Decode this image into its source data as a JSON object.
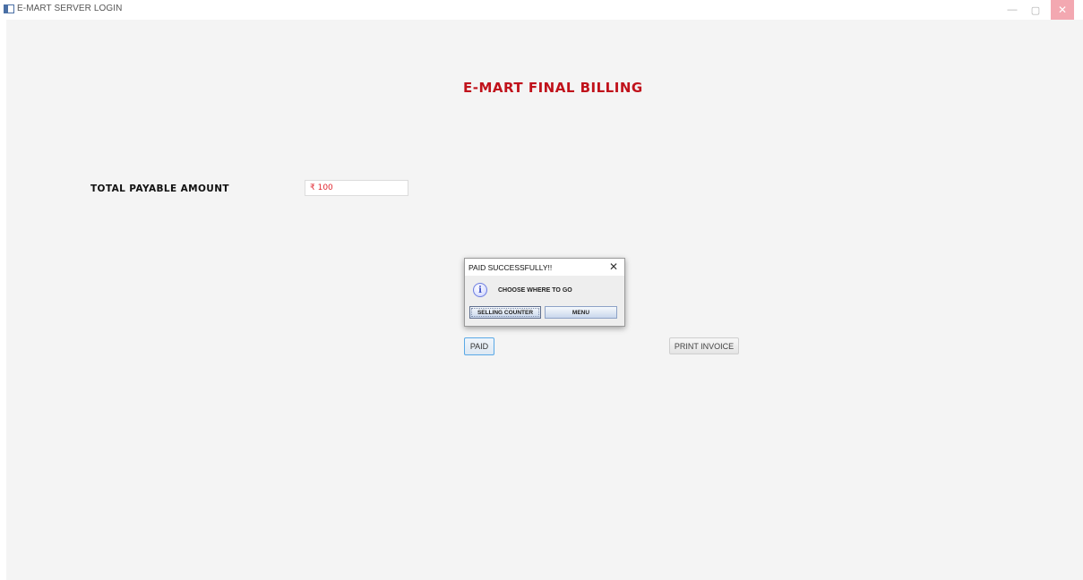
{
  "window": {
    "title": "E-MART SERVER LOGIN",
    "controls": {
      "minimize": "—",
      "maximize": "▢",
      "close": "✕"
    },
    "close_color": "#f3a8b1"
  },
  "page": {
    "title": "E-MART FINAL BILLING",
    "title_color": "#c0121b",
    "total_label": "TOTAL PAYABLE AMOUNT",
    "amount_value": "₹ 100",
    "amount_color": "#e0262f",
    "paid_label": "PAID",
    "print_label": "PRINT INVOICE"
  },
  "dialog": {
    "title": "PAID SUCCESSFULLY!!",
    "close_glyph": "✕",
    "icon": "info-icon",
    "icon_glyph": "i",
    "message": "CHOOSE WHERE TO GO",
    "buttons": {
      "selling_counter": "SELLING COUNTER",
      "menu": "MENU"
    }
  }
}
